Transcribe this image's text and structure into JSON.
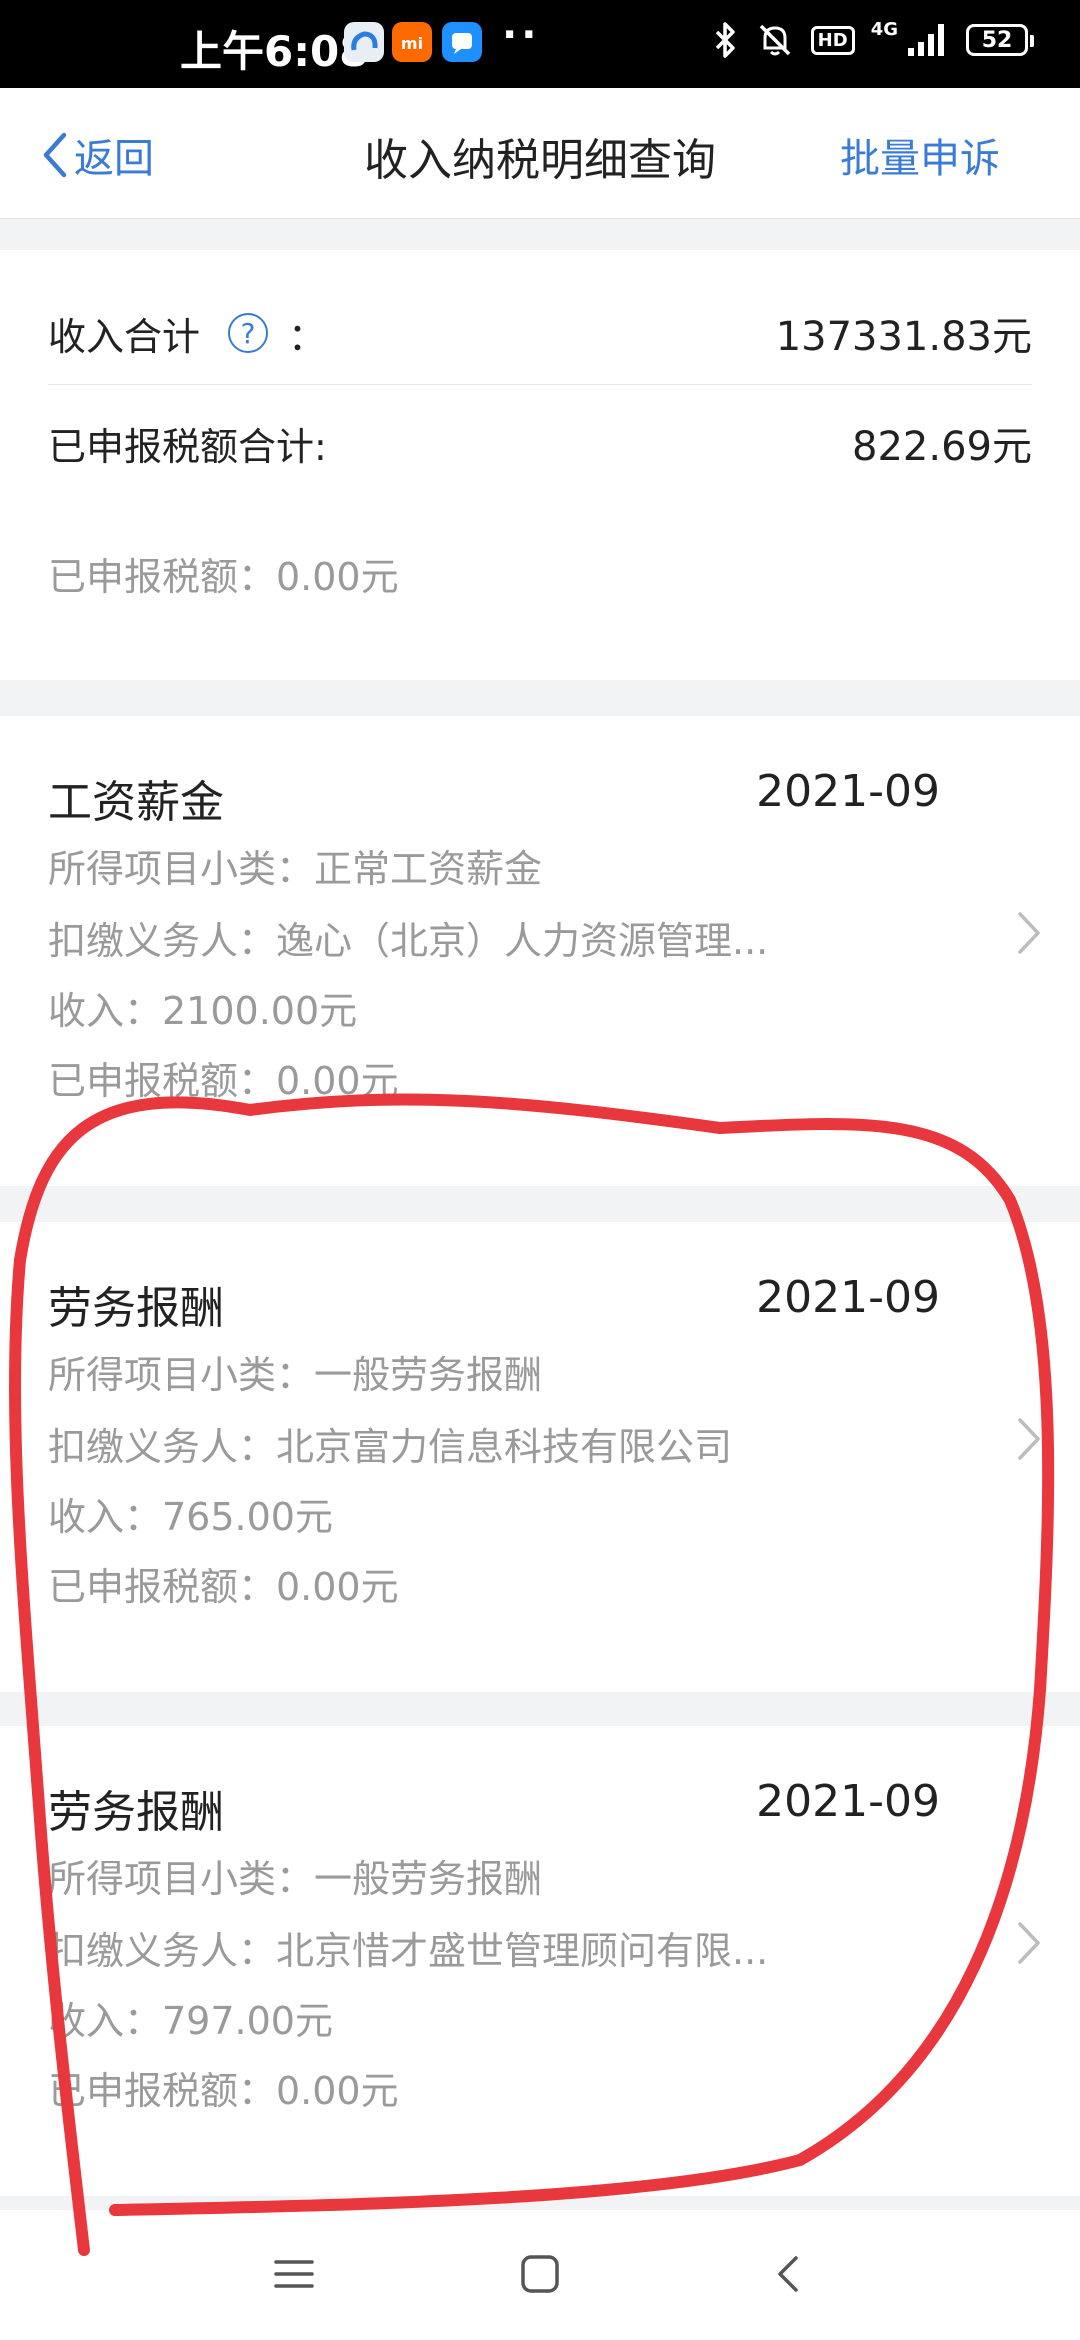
{
  "status_bar": {
    "time": "上午6:08",
    "dots": "··",
    "hd": "HD",
    "network": "4G",
    "battery": "52",
    "icons": [
      "app-icon-cloud",
      "app-icon-mi",
      "app-icon-message",
      "bluetooth-icon",
      "mute-icon",
      "signal-icon",
      "battery-icon"
    ]
  },
  "header": {
    "back_label": "返回",
    "title": "收入纳税明细查询",
    "action_label": "批量申诉"
  },
  "summary": {
    "income_label": "收入合计",
    "colon": "：",
    "income_value": "137331.83元",
    "tax_label": "已申报税额合计:",
    "tax_value": "822.69元",
    "partial_line": "已申报税额：0.00元"
  },
  "records": [
    {
      "type": "工资薪金",
      "date": "2021-09",
      "subcategory": "所得项目小类：正常工资薪金",
      "withholder": "扣缴义务人：逸心（北京）人力资源管理...",
      "income": "收入：2100.00元",
      "tax": "已申报税额：0.00元"
    },
    {
      "type": "劳务报酬",
      "date": "2021-09",
      "subcategory": "所得项目小类：一般劳务报酬",
      "withholder": "扣缴义务人：北京富力信息科技有限公司",
      "income": "收入：765.00元",
      "tax": "已申报税额：0.00元"
    },
    {
      "type": "劳务报酬",
      "date": "2021-09",
      "subcategory": "所得项目小类：一般劳务报酬",
      "withholder": "扣缴义务人：北京惜才盛世管理顾问有限...",
      "income": "收入：797.00元",
      "tax": "已申报税额：0.00元"
    }
  ],
  "colors": {
    "accent": "#3a7bd5",
    "annotation": "#e8383d",
    "muted_text": "#9a9a9a",
    "background": "#f2f3f5"
  }
}
